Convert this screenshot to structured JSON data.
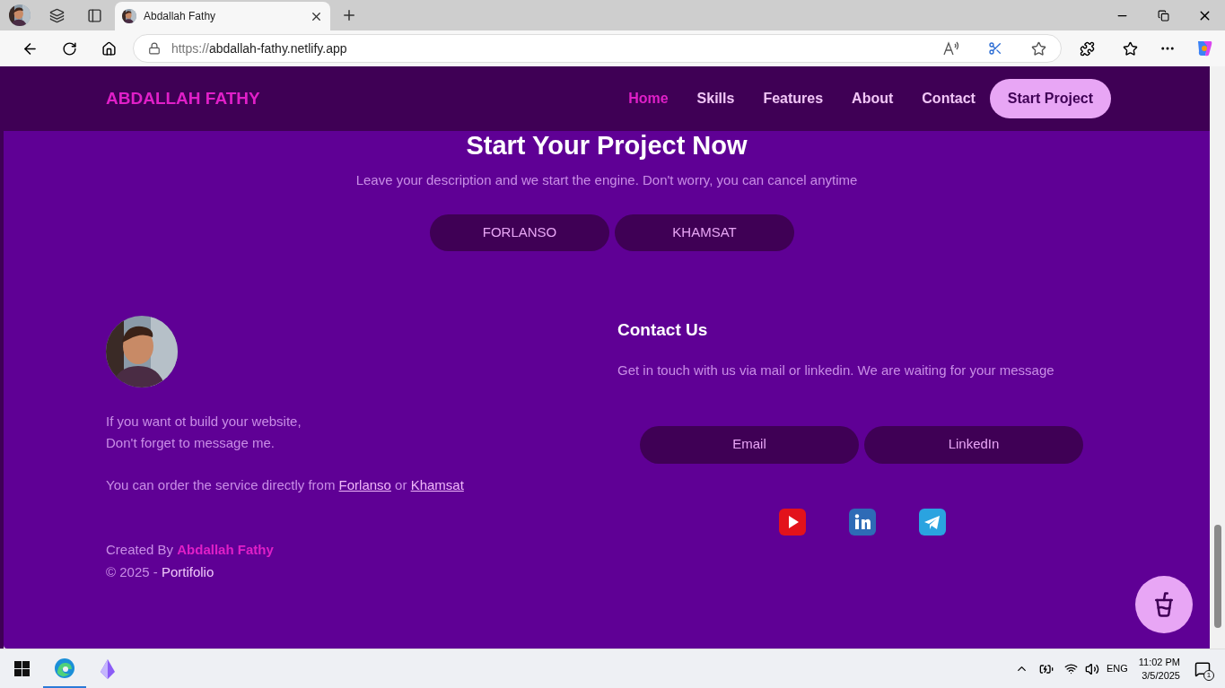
{
  "browser": {
    "tab_title": "Abdallah Fathy",
    "url_prefix": "https://",
    "url_host": "abdallah-fathy.netlify.app"
  },
  "nav": {
    "brand": "ABDALLAH FATHY",
    "links": [
      {
        "label": "Home",
        "selected": true
      },
      {
        "label": "Skills",
        "selected": false
      },
      {
        "label": "Features",
        "selected": false
      },
      {
        "label": "About",
        "selected": false
      },
      {
        "label": "Contact",
        "selected": false
      }
    ],
    "cta": "Start Project"
  },
  "hero": {
    "title": "Start Your Project Now",
    "subtitle": "Leave your description and we start the engine. Don't worry, you can cancel anytime",
    "buttons": [
      "FORLANSO",
      "KHAMSAT"
    ]
  },
  "about": {
    "lines": [
      "If you want ot build your website,",
      "Don't forget to message me."
    ],
    "order": {
      "before": "You can order the service directly from",
      "link_1": "Forlanso",
      "between": "or",
      "link_2": "Khamsat"
    },
    "credit": {
      "label": "Created By",
      "name": "Abdallah Fathy"
    },
    "copyright": {
      "label": "© 2025 -",
      "name": "Portifolio"
    }
  },
  "contact": {
    "title": "Contact Us",
    "text": "Get in touch with us via mail or linkedin. We are waiting for your message",
    "buttons": [
      "Email",
      "LinkedIn"
    ],
    "socials": [
      {
        "kind": "youtube"
      },
      {
        "kind": "linkedin"
      },
      {
        "kind": "telegram"
      }
    ]
  },
  "taskbar": {
    "language": "ENG",
    "time": "11:02 PM",
    "date": "3/5/2025",
    "notifications": "1"
  }
}
